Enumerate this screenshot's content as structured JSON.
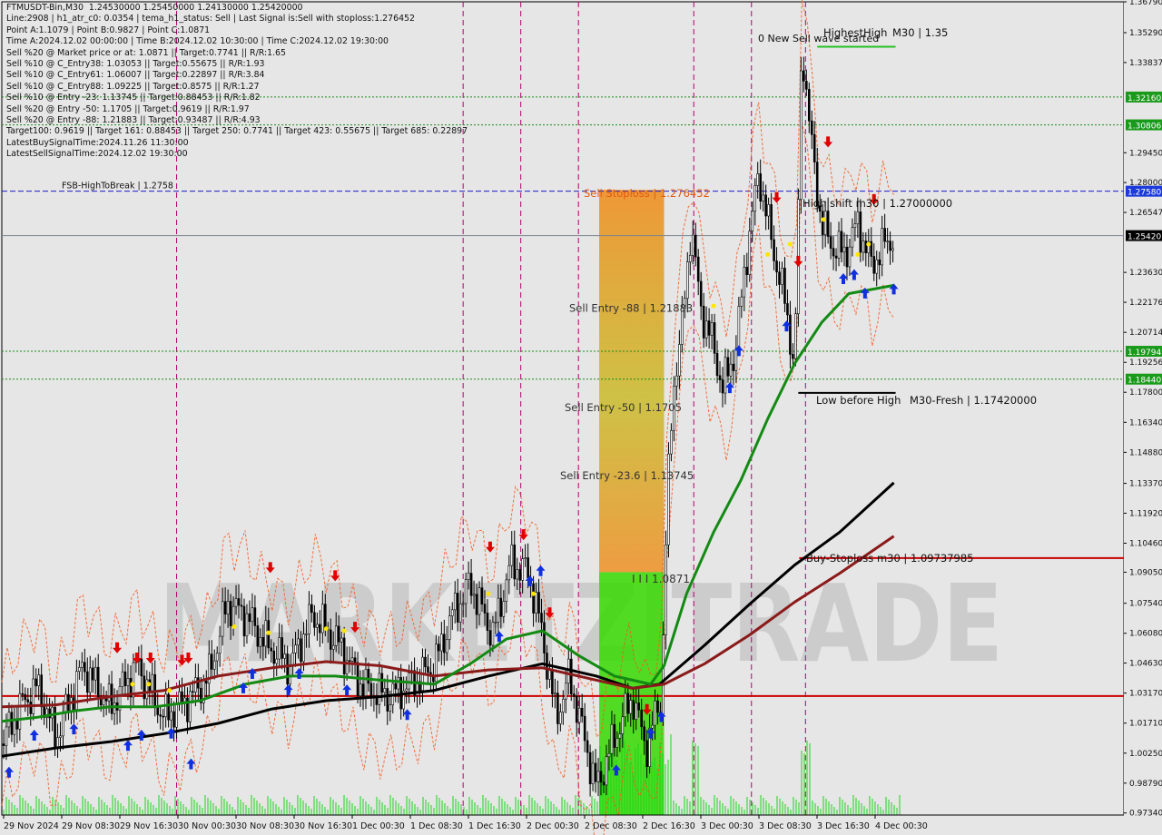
{
  "info_lines": [
    "FTMUSDT-Bin,M30  1.24530000 1.25450000 1.24130000 1.25420000",
    "Line:2908 | h1_atr_c0: 0.0354 | tema_h1_status: Sell | Last Signal is:Sell with stoploss:1.276452",
    "Point A:1.1079 | Point B:0.9827 | Point C:1.0871",
    "Time A:2024.12.02 00:00:00 | Time B:2024.12.02 10:30:00 | Time C:2024.12.02 19:30:00",
    "Sell %20 @ Market price or at: 1.0871 || Target:0.7741 || R/R:1.65",
    "Sell %10 @ C_Entry38: 1.03053 || Target:0.55675 || R/R:1.93",
    "Sell %10 @ C_Entry61: 1.06007 || Target:0.22897 || R/R:3.84",
    "Sell %10 @ C_Entry88: 1.09225 || Target:0.8575 || R/R:1.27",
    "Sell %10 @ Entry -23: 1.13745 || Target:0.88453 || R/R:1.82",
    "Sell %20 @ Entry -50: 1.1705 || Target:0.9619 || R/R:1.97",
    "Sell %20 @ Entry -88: 1.21883 || Target:0.93487 || R/R:4.93",
    "Target100: 0.9619 || Target 161: 0.88453 || Target 250: 0.7741 || Target 423: 0.55675 || Target 685: 0.22897",
    "LatestBuySignalTime:2024.11.26 11:30:00",
    "LatestSellSignalTime:2024.12.02 19:30:00"
  ],
  "watermark": "MARKETZITRADE",
  "colors": {
    "background": "#e6e6e6",
    "candle": "#000000",
    "ma_green": "#138a13",
    "ma_maroon": "#8b1a1a",
    "ma_black": "#000000",
    "support_red": "#cc0000",
    "resistance_blue": "#1a1acc",
    "dotted_green": "#1a8a1a",
    "vline_magenta": "#b0006f",
    "zone_top": "#f08a18",
    "zone_mid": "#c8b81e",
    "zone_green": "#36d900",
    "volume": "#18d418",
    "buy_arrow": "#1030e0",
    "sell_arrow": "#e00000",
    "signal_dot": "#ffe600",
    "current_price_bg": "#000000",
    "green_label_bg": "#1a9a1a",
    "blue_label_bg": "#1a3adb"
  },
  "annotations": {
    "fsb_label": "FSB-HighToBreak | 1.2758",
    "sell_stoploss": "Sell Stoploss | 1.276452",
    "sell_entry_88": "Sell Entry -88 | 1.21883",
    "sell_entry_50": "Sell Entry -50 | 1.1705",
    "sell_entry_23": "Sell Entry -23.6 | 1.13745",
    "point_c_label": "I I I 1.0871",
    "highest_high_label": "HighestHigh",
    "highest_high_value": "M30 | 1.35",
    "new_sell_wave": "0 New Sell wave started",
    "high_shift": "High shift m30 | 1.27000000",
    "low_before_high": "Low before High",
    "m30_fresh": "M30-Fresh | 1.17420000",
    "buy_stoploss": "Buy-Stoploss m30 | 1.09737985"
  },
  "chart_data": {
    "type": "candlestick",
    "symbol": "FTMUSDT-Bin",
    "timeframe": "M30",
    "y_range": [
      0.9724,
      1.3679
    ],
    "y_ticks": [
      "1.36790",
      "1.35290",
      "1.33837",
      "1.32160",
      "1.30806",
      "1.29450",
      "1.28000",
      "1.27580",
      "1.26547",
      "1.25420",
      "1.23630",
      "1.22176",
      "1.20714",
      "1.19794",
      "1.19256",
      "1.18440",
      "1.17800",
      "1.16340",
      "1.14880",
      "1.13370",
      "1.11920",
      "1.10460",
      "1.09050",
      "1.07540",
      "1.06080",
      "1.04630",
      "1.03170",
      "1.01710",
      "1.00250",
      "0.98790",
      "0.97340"
    ],
    "x_ticks": [
      "29 Nov 2024",
      "29 Nov 08:30",
      "29 Nov 16:30",
      "30 Nov 00:30",
      "30 Nov 08:30",
      "30 Nov 16:30",
      "1 Dec 00:30",
      "1 Dec 08:30",
      "1 Dec 16:30",
      "2 Dec 00:30",
      "2 Dec 08:30",
      "2 Dec 16:30",
      "3 Dec 00:30",
      "3 Dec 08:30",
      "3 Dec 16:30",
      "4 Dec 00:30"
    ],
    "ohlc_current": {
      "open": 1.2453,
      "high": 1.2545,
      "low": 1.2413,
      "close": 1.2542
    },
    "current_price": 1.2542,
    "levels": {
      "fsb_high_to_break": 1.2758,
      "sell_stoploss": 1.276452,
      "dotted_green": [
        1.3216,
        1.30806,
        1.19794,
        1.1844
      ],
      "current_price_line": 1.2542,
      "support_red": 1.0303,
      "buy_stoploss": 1.09737985,
      "highest_high": 1.35,
      "high_shift": 1.27,
      "m30_fresh": 1.1742
    },
    "price_path": [
      [
        0,
        1.007
      ],
      [
        20,
        1.025
      ],
      [
        40,
        1.035
      ],
      [
        60,
        1.01
      ],
      [
        90,
        1.045
      ],
      [
        120,
        1.025
      ],
      [
        150,
        1.045
      ],
      [
        180,
        1.02
      ],
      [
        210,
        1.03
      ],
      [
        230,
        1.04
      ],
      [
        250,
        1.075
      ],
      [
        270,
        1.07
      ],
      [
        295,
        1.055
      ],
      [
        320,
        1.045
      ],
      [
        345,
        1.07
      ],
      [
        375,
        1.055
      ],
      [
        400,
        1.035
      ],
      [
        430,
        1.03
      ],
      [
        460,
        1.038
      ],
      [
        480,
        1.045
      ],
      [
        500,
        1.07
      ],
      [
        520,
        1.085
      ],
      [
        545,
        1.06
      ],
      [
        565,
        1.095
      ],
      [
        585,
        1.09
      ],
      [
        600,
        1.06
      ],
      [
        615,
        1.02
      ],
      [
        630,
        1.04
      ],
      [
        660,
        0.985
      ],
      [
        680,
        1.01
      ],
      [
        700,
        1.03
      ],
      [
        715,
        1.005
      ],
      [
        725,
        1.02
      ],
      [
        732,
        1.03
      ],
      [
        738,
        1.12
      ],
      [
        745,
        1.18
      ],
      [
        755,
        1.21
      ],
      [
        765,
        1.26
      ],
      [
        775,
        1.22
      ],
      [
        790,
        1.2
      ],
      [
        800,
        1.18
      ],
      [
        815,
        1.2
      ],
      [
        825,
        1.24
      ],
      [
        840,
        1.285
      ],
      [
        855,
        1.25
      ],
      [
        870,
        1.22
      ],
      [
        880,
        1.19
      ],
      [
        888,
        1.35
      ],
      [
        898,
        1.3
      ],
      [
        910,
        1.26
      ],
      [
        920,
        1.25
      ],
      [
        935,
        1.245
      ],
      [
        950,
        1.26
      ],
      [
        965,
        1.24
      ],
      [
        980,
        1.25
      ],
      [
        990,
        1.254
      ]
    ],
    "ma_green": [
      [
        0,
        1.018
      ],
      [
        40,
        1.02
      ],
      [
        80,
        1.023
      ],
      [
        120,
        1.025
      ],
      [
        170,
        1.025
      ],
      [
        220,
        1.028
      ],
      [
        270,
        1.036
      ],
      [
        320,
        1.04
      ],
      [
        370,
        1.04
      ],
      [
        420,
        1.038
      ],
      [
        480,
        1.036
      ],
      [
        520,
        1.046
      ],
      [
        560,
        1.058
      ],
      [
        600,
        1.062
      ],
      [
        640,
        1.05
      ],
      [
        680,
        1.04
      ],
      [
        720,
        1.036
      ],
      [
        735,
        1.045
      ],
      [
        760,
        1.08
      ],
      [
        790,
        1.11
      ],
      [
        820,
        1.135
      ],
      [
        850,
        1.165
      ],
      [
        880,
        1.192
      ],
      [
        910,
        1.212
      ],
      [
        940,
        1.226
      ],
      [
        990,
        1.23
      ]
    ],
    "ma_maroon": [
      [
        0,
        1.025
      ],
      [
        60,
        1.026
      ],
      [
        120,
        1.03
      ],
      [
        180,
        1.033
      ],
      [
        240,
        1.04
      ],
      [
        300,
        1.044
      ],
      [
        360,
        1.047
      ],
      [
        420,
        1.045
      ],
      [
        480,
        1.04
      ],
      [
        540,
        1.043
      ],
      [
        600,
        1.044
      ],
      [
        660,
        1.038
      ],
      [
        700,
        1.034
      ],
      [
        735,
        1.036
      ],
      [
        780,
        1.046
      ],
      [
        830,
        1.06
      ],
      [
        880,
        1.076
      ],
      [
        930,
        1.09
      ],
      [
        990,
        1.108
      ]
    ],
    "ma_black": [
      [
        0,
        1.001
      ],
      [
        60,
        1.005
      ],
      [
        120,
        1.008
      ],
      [
        180,
        1.012
      ],
      [
        240,
        1.017
      ],
      [
        300,
        1.024
      ],
      [
        360,
        1.028
      ],
      [
        420,
        1.03
      ],
      [
        480,
        1.033
      ],
      [
        540,
        1.04
      ],
      [
        600,
        1.046
      ],
      [
        660,
        1.04
      ],
      [
        700,
        1.034
      ],
      [
        730,
        1.036
      ],
      [
        780,
        1.055
      ],
      [
        830,
        1.075
      ],
      [
        880,
        1.094
      ],
      [
        930,
        1.11
      ],
      [
        990,
        1.134
      ]
    ],
    "buy_signals": [
      [
        8,
        0.999
      ],
      [
        36,
        1.017
      ],
      [
        80,
        1.02
      ],
      [
        140,
        1.012
      ],
      [
        155,
        1.017
      ],
      [
        188,
        1.018
      ],
      [
        210,
        1.003
      ],
      [
        268,
        1.04
      ],
      [
        278,
        1.047
      ],
      [
        318,
        1.039
      ],
      [
        330,
        1.047
      ],
      [
        383,
        1.039
      ],
      [
        450,
        1.027
      ],
      [
        552,
        1.065
      ],
      [
        586,
        1.092
      ],
      [
        598,
        1.097
      ],
      [
        682,
        1.0
      ],
      [
        720,
        1.018
      ],
      [
        732,
        1.026
      ],
      [
        808,
        1.186
      ],
      [
        818,
        1.204
      ],
      [
        871,
        1.216
      ],
      [
        934,
        1.239
      ],
      [
        946,
        1.241
      ],
      [
        958,
        1.232
      ],
      [
        990,
        1.234
      ]
    ],
    "sell_signals": [
      [
        128,
        1.048
      ],
      [
        150,
        1.043
      ],
      [
        165,
        1.043
      ],
      [
        200,
        1.042
      ],
      [
        207,
        1.043
      ],
      [
        298,
        1.087
      ],
      [
        370,
        1.083
      ],
      [
        392,
        1.058
      ],
      [
        542,
        1.097
      ],
      [
        579,
        1.103
      ],
      [
        608,
        1.065
      ],
      [
        716,
        1.018
      ],
      [
        860,
        1.267
      ],
      [
        884,
        1.236
      ],
      [
        917,
        1.294
      ],
      [
        968,
        1.266
      ]
    ],
    "signal_dots": [
      [
        145,
        1.036
      ],
      [
        163,
        1.036
      ],
      [
        186,
        1.033
      ],
      [
        258,
        1.064
      ],
      [
        296,
        1.061
      ],
      [
        360,
        1.063
      ],
      [
        380,
        1.062
      ],
      [
        540,
        1.08
      ],
      [
        590,
        1.08
      ],
      [
        790,
        1.22
      ],
      [
        850,
        1.245
      ],
      [
        875,
        1.25
      ],
      [
        912,
        1.262
      ],
      [
        950,
        1.245
      ],
      [
        962,
        1.25
      ]
    ],
    "vertical_times": [
      194,
      512,
      576,
      640,
      768,
      832,
      892
    ]
  }
}
